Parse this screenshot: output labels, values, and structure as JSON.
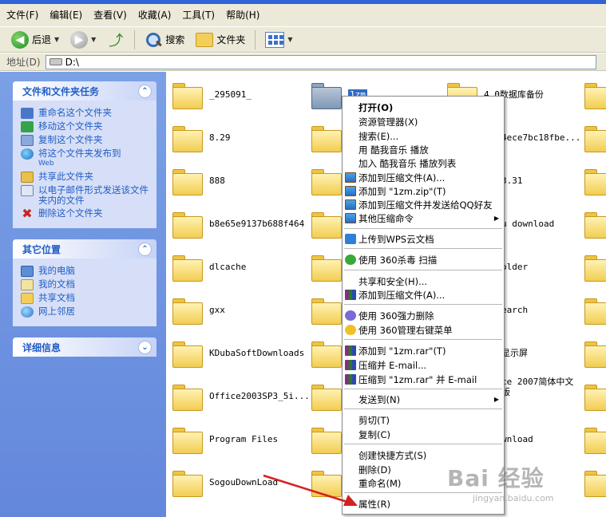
{
  "menubar": {
    "items": [
      "文件(F)",
      "编辑(E)",
      "查看(V)",
      "收藏(A)",
      "工具(T)",
      "帮助(H)"
    ]
  },
  "toolbar": {
    "back_label": "后退",
    "search_label": "搜索",
    "folders_label": "文件夹"
  },
  "address": {
    "label": "地址(D)",
    "value": "D:\\"
  },
  "leftpane": {
    "tasks_title": "文件和文件夹任务",
    "tasks": [
      {
        "label": "重命名这个文件夹",
        "icon": "rename-icon"
      },
      {
        "label": "移动这个文件夹",
        "icon": "move-icon"
      },
      {
        "label": "复制这个文件夹",
        "icon": "copy-icon"
      },
      {
        "label": "将这个文件夹发布到",
        "sub": "Web",
        "icon": "publish-web-icon"
      },
      {
        "label": "共享此文件夹",
        "icon": "share-icon"
      },
      {
        "label": "以电子邮件形式发送该文件夹内的文件",
        "icon": "email-icon"
      },
      {
        "label": "删除这个文件夹",
        "icon": "delete-icon"
      }
    ],
    "places_title": "其它位置",
    "places": [
      {
        "label": "我的电脑",
        "icon": "my-computer-icon"
      },
      {
        "label": "我的文档",
        "icon": "my-documents-icon"
      },
      {
        "label": "共享文档",
        "icon": "shared-documents-icon"
      },
      {
        "label": "网上邻居",
        "icon": "network-icon"
      }
    ],
    "details_title": "详细信息"
  },
  "files": {
    "col1": [
      "_295091_",
      "8.29",
      "888",
      "b8e65e9137b688f464",
      "dlcache",
      "gxx",
      "KDubaSoftDownloads",
      "Office2003SP3_5i...",
      "Program Files",
      "SogouDownLoad"
    ],
    "selected": "1zm",
    "col3_a": "4.0数据库备份",
    "col3": [
      "4ece7bc18fbe...",
      "3.31",
      "u download",
      "older",
      "earch",
      "显示屏",
      "ce 2007简体中文版",
      "wnload"
    ]
  },
  "context_menu": {
    "items": [
      {
        "label": "打开(O)",
        "bold": true
      },
      {
        "label": "资源管理器(X)"
      },
      {
        "label": "搜索(E)..."
      },
      {
        "label": "用 酷我音乐 播放"
      },
      {
        "label": "加入 酷我音乐 播放列表"
      },
      {
        "label": "添加到压缩文件(A)...",
        "icon": "zip"
      },
      {
        "label": "添加到 \"1zm.zip\"(T)",
        "icon": "zip"
      },
      {
        "label": "添加到压缩文件并发送给QQ好友",
        "icon": "zip"
      },
      {
        "label": "其他压缩命令",
        "icon": "zip",
        "submenu": true
      },
      {
        "label": "上传到WPS云文档",
        "icon": "wps"
      },
      {
        "label": "使用 360杀毒 扫描",
        "icon": "360"
      },
      {
        "label": "共享和安全(H)..."
      },
      {
        "label": "添加到压缩文件(A)...",
        "icon": "rar"
      },
      {
        "label": "使用 360强力删除",
        "icon": "360b"
      },
      {
        "label": "使用 360管理右键菜单",
        "icon": "360c"
      },
      {
        "label": "添加到 \"1zm.rar\"(T)",
        "icon": "rar"
      },
      {
        "label": "压缩并 E-mail...",
        "icon": "rar"
      },
      {
        "label": "压缩到 \"1zm.rar\" 并 E-mail",
        "icon": "rar"
      },
      {
        "label": "发送到(N)",
        "submenu": true
      },
      {
        "label": "剪切(T)"
      },
      {
        "label": "复制(C)"
      },
      {
        "label": "创建快捷方式(S)"
      },
      {
        "label": "删除(D)"
      },
      {
        "label": "重命名(M)"
      },
      {
        "label": "属性(R)"
      }
    ]
  },
  "watermark": {
    "big": "Bai 经验",
    "small": "jingyan.baidu.com"
  },
  "colors": {
    "accent": "#215dc6",
    "pane": "#6d93e2",
    "annotation": "#d42020"
  }
}
